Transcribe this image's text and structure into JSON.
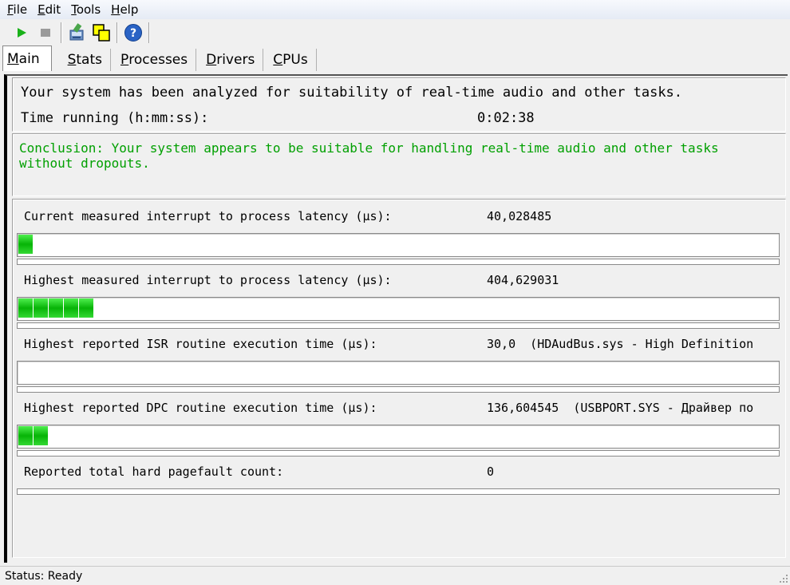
{
  "menu": {
    "file": {
      "accel": "F",
      "rest": "ile"
    },
    "edit": {
      "accel": "E",
      "rest": "dit"
    },
    "tools": {
      "accel": "T",
      "rest": "ools"
    },
    "help": {
      "accel": "H",
      "rest": "elp"
    }
  },
  "toolbar": {
    "icons": [
      "play-icon",
      "stop-icon",
      "find-driver-icon",
      "windows-icon",
      "help-icon"
    ]
  },
  "tabs": [
    {
      "accel": "M",
      "rest": "ain",
      "active": true
    },
    {
      "accel": "S",
      "rest": "tats"
    },
    {
      "accel": "P",
      "rest": "rocesses"
    },
    {
      "accel": "D",
      "rest": "rivers"
    },
    {
      "accel": "C",
      "rest": "PUs"
    }
  ],
  "summary": {
    "analyzed": "Your system has been analyzed for suitability of real-time audio and other tasks.",
    "time_label": "Time running (h:mm:ss):",
    "time_value": "0:02:38"
  },
  "conclusion": {
    "text": "Conclusion: Your system appears to be suitable for handling real-time audio and other tasks without dropouts.",
    "color": "#00a000"
  },
  "metrics": [
    {
      "label": "Current measured interrupt to process latency (µs):",
      "value": "40,028485",
      "bar_segments": 1
    },
    {
      "label": "Highest measured interrupt to process latency (µs):",
      "value": "404,629031",
      "bar_segments": 5
    },
    {
      "label": "Highest reported ISR routine execution time (µs):",
      "value": "30,0  (HDAudBus.sys - High Definition",
      "bar_segments": 0
    },
    {
      "label": "Highest reported DPC routine execution time (µs):",
      "value": "136,604545  (USBPORT.SYS - Драйвер по",
      "bar_segments": 2
    },
    {
      "label": "Reported total hard pagefault count:",
      "value": "0"
    }
  ],
  "status": {
    "text": "Status: Ready"
  },
  "colors": {
    "bar_green": "#07b407",
    "menubar": "#e5ebf5"
  }
}
